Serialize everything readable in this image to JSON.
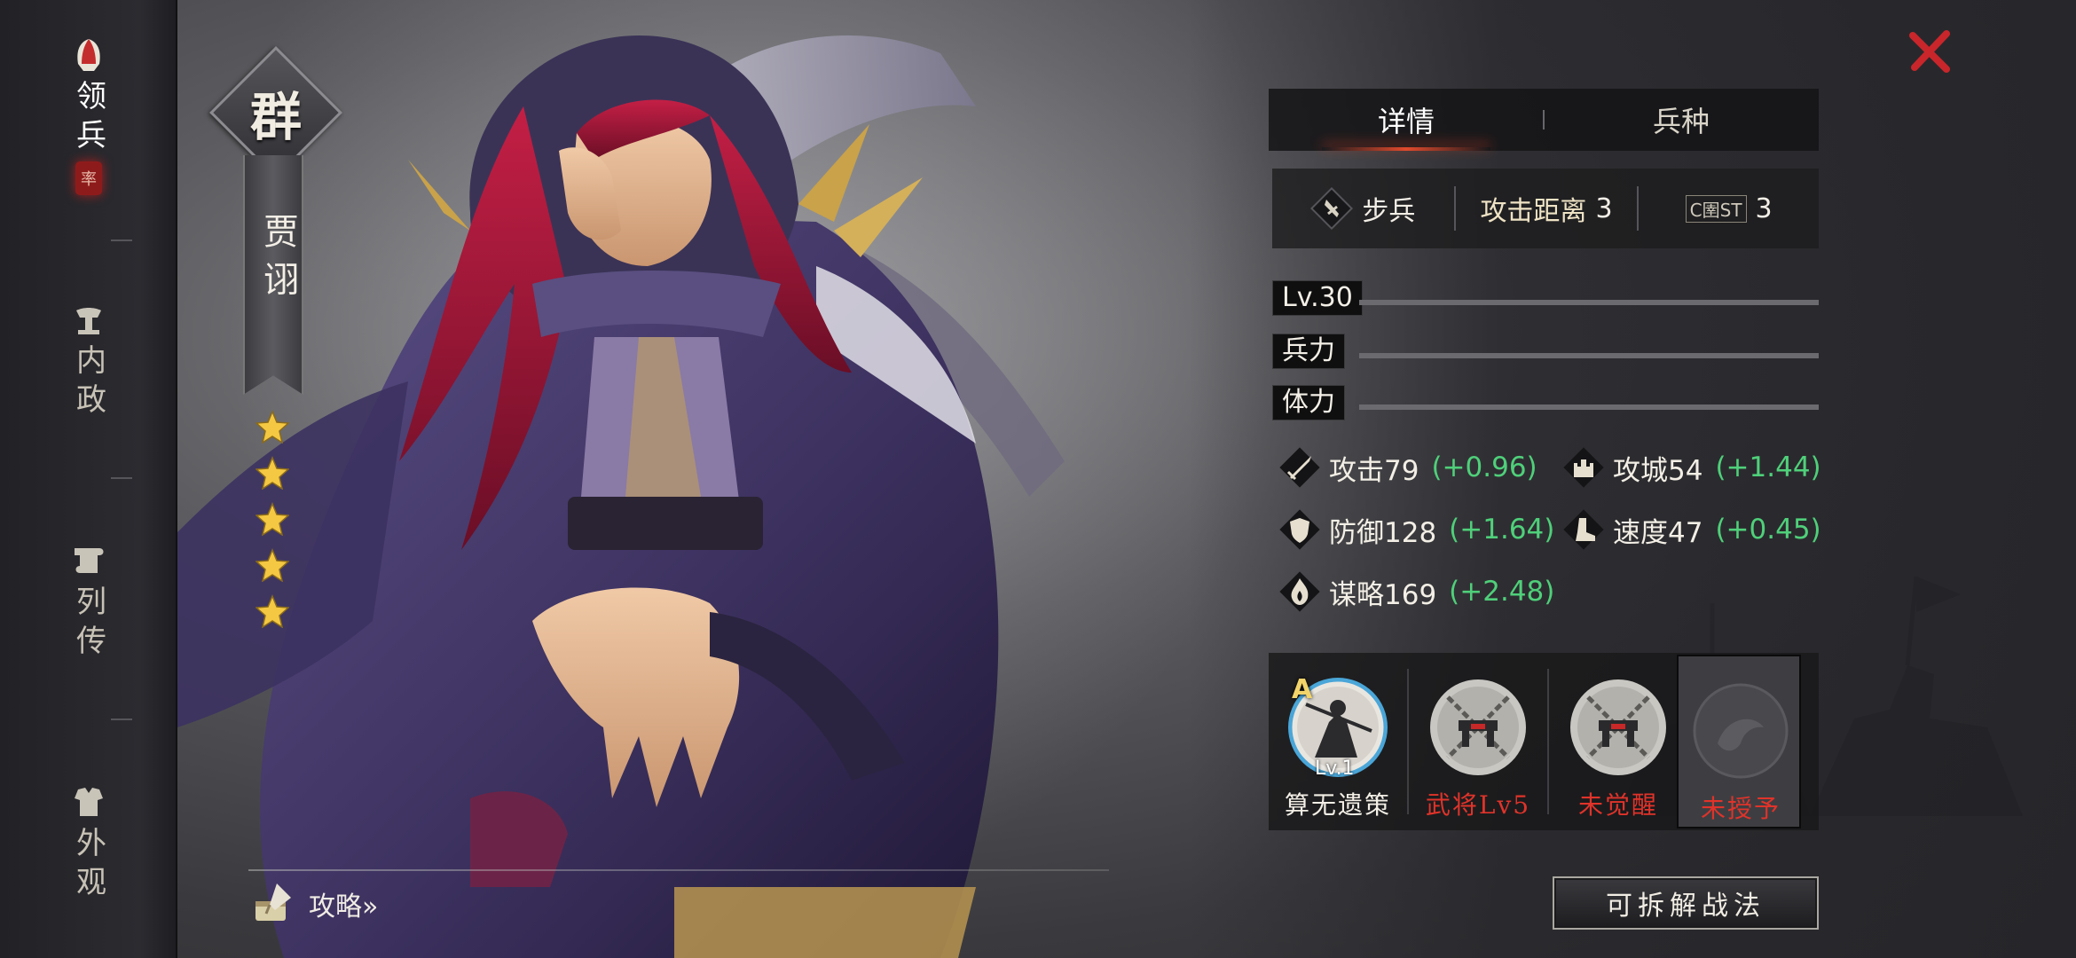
{
  "sidebar": {
    "items": [
      {
        "label": "领兵",
        "icon": "helmet-icon",
        "active": true
      },
      {
        "label": "内政",
        "icon": "lamp-icon",
        "active": false
      },
      {
        "label": "列传",
        "icon": "scroll-icon",
        "active": false
      },
      {
        "label": "外观",
        "icon": "armor-icon",
        "active": false
      }
    ],
    "seal_text": "率"
  },
  "hero": {
    "faction": "群",
    "name": "贾诩",
    "stars": 5
  },
  "guide": {
    "label": "攻略»"
  },
  "tabs": [
    {
      "label": "详情",
      "active": true
    },
    {
      "label": "兵种",
      "active": false
    }
  ],
  "unit": {
    "type": "步兵",
    "range_label": "攻击距离",
    "range_value": "3",
    "cost_icon_text": "C圉ST",
    "cost_value": "3"
  },
  "bars": {
    "level": "Lv.30",
    "troops": "兵力",
    "stamina": "体力"
  },
  "attributes": [
    {
      "key": "attack",
      "label": "攻击79",
      "gain": "(+0.96)",
      "icon": "sword-icon"
    },
    {
      "key": "siege",
      "label": "攻城54",
      "gain": "(+1.44)",
      "icon": "castle-icon"
    },
    {
      "key": "defense",
      "label": "防御128",
      "gain": "(+1.64)",
      "icon": "shield-icon"
    },
    {
      "key": "speed",
      "label": "速度47",
      "gain": "(+0.45)",
      "icon": "boot-icon"
    },
    {
      "key": "strategy",
      "label": "谋略169",
      "gain": "(+2.48)",
      "icon": "flame-icon"
    }
  ],
  "skills": [
    {
      "name": "算无遗策",
      "grade": "A",
      "level": "Lv.1",
      "state": "learned"
    },
    {
      "name": "武将Lv5",
      "state": "locked"
    },
    {
      "name": "未觉醒",
      "state": "locked"
    },
    {
      "name": "未授予",
      "state": "empty"
    }
  ],
  "disassemble_button": "可拆解战法",
  "colors": {
    "gain_green": "#4fd07a",
    "locked_red": "#e0332a",
    "close_red": "#c8262b",
    "tab_underline": "#e04a2c",
    "grade_gold": "#f2d46a"
  }
}
